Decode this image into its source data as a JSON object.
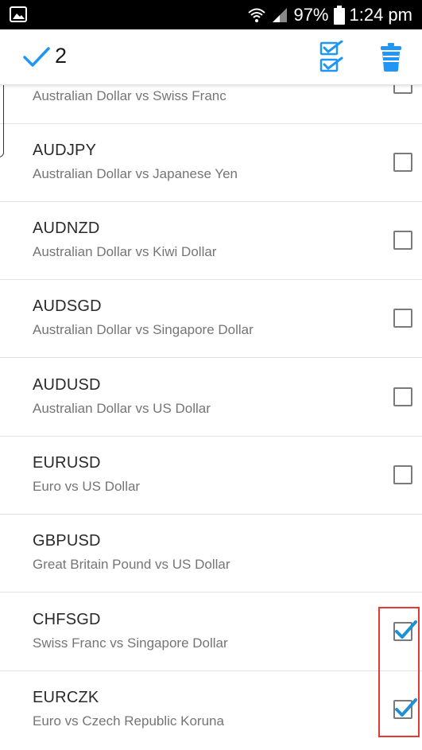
{
  "status_bar": {
    "battery": "97%",
    "time": "1:24 pm",
    "icons": [
      "image-icon",
      "wifi-icon",
      "signal-icon",
      "battery-icon"
    ]
  },
  "action_bar": {
    "selected_count": "2",
    "icons": [
      "check-icon",
      "select-all-icon",
      "delete-icon"
    ],
    "accent_color": "#2196f3"
  },
  "pairs": [
    {
      "code": "",
      "desc": "Australian Dollar vs Swiss Franc",
      "checked": false
    },
    {
      "code": "AUDJPY",
      "desc": "Australian Dollar vs Japanese Yen",
      "checked": false
    },
    {
      "code": "AUDNZD",
      "desc": "Australian Dollar vs Kiwi Dollar",
      "checked": false
    },
    {
      "code": "AUDSGD",
      "desc": "Australian Dollar vs Singapore Dollar",
      "checked": false
    },
    {
      "code": "AUDUSD",
      "desc": "Australian Dollar vs US Dollar",
      "checked": false
    },
    {
      "code": "EURUSD",
      "desc": "Euro vs US Dollar",
      "checked": false
    },
    {
      "code": "GBPUSD",
      "desc": "Great Britain Pound vs US Dollar",
      "checked": null
    },
    {
      "code": "CHFSGD",
      "desc": "Swiss Franc vs Singapore Dollar",
      "checked": true
    },
    {
      "code": "EURCZK",
      "desc": "Euro vs Czech Republic Koruna",
      "checked": true
    }
  ]
}
